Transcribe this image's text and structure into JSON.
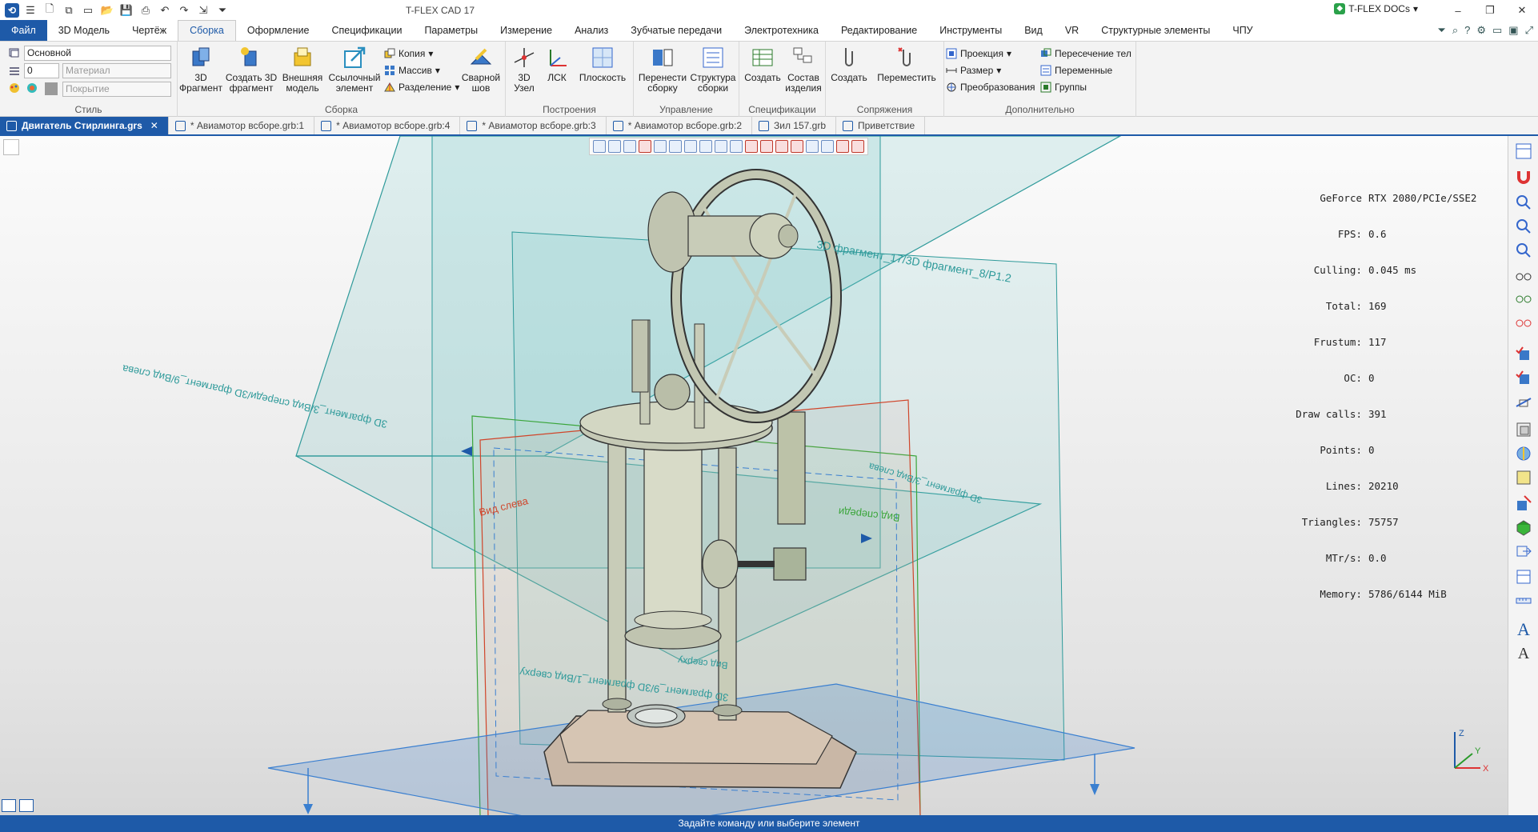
{
  "app": {
    "title": "T-FLEX CAD 17",
    "docs_label": "T-FLEX DOCs"
  },
  "menu": {
    "tabs": [
      "Файл",
      "3D Модель",
      "Чертёж",
      "Сборка",
      "Оформление",
      "Спецификации",
      "Параметры",
      "Измерение",
      "Анализ",
      "Зубчатые передачи",
      "Электротехника",
      "Редактирование",
      "Инструменты",
      "Вид",
      "VR",
      "Структурные элементы",
      "ЧПУ"
    ],
    "active": "Сборка"
  },
  "ribbon": {
    "style": {
      "label": "Стиль",
      "layer_value": "Основной",
      "level_value": "0",
      "material_placeholder": "Материал",
      "coating_placeholder": "Покрытие"
    },
    "assembly": {
      "label": "Сборка",
      "fragment_3d": "3D\nФрагмент",
      "create_fragment": "Создать 3D\nфрагмент",
      "external_model": "Внешняя\nмодель",
      "ref_element": "Ссылочный\nэлемент",
      "copy": "Копия",
      "array": "Массив",
      "split": "Разделение",
      "weld": "Сварной\nшов"
    },
    "construct": {
      "label": "Построения",
      "node3d": "3D\nУзел",
      "lcs": "ЛСК",
      "plane": "Плоскость"
    },
    "manage": {
      "label": "Управление",
      "move_asm": "Перенести\nсборку",
      "asm_structure": "Структура\nсборки"
    },
    "specs": {
      "label": "Спецификации",
      "create": "Создать",
      "products": "Состав\nизделия"
    },
    "mates": {
      "label": "Сопряжения",
      "create": "Создать",
      "move": "Переместить"
    },
    "extra": {
      "label": "Дополнительно",
      "projection": "Проекция",
      "dimension": "Размер",
      "transforms": "Преобразования",
      "body_intersect": "Пересечение тел",
      "variables": "Переменные",
      "groups": "Группы"
    }
  },
  "doc_tabs": [
    {
      "label": "Двигатель Стирлинга.grs",
      "active": true
    },
    {
      "label": "* Авиамотор всборе.grb:1",
      "active": false
    },
    {
      "label": "* Авиамотор всборе.grb:4",
      "active": false
    },
    {
      "label": "* Авиамотор всборе.grb:3",
      "active": false
    },
    {
      "label": "* Авиамотор всборе.grb:2",
      "active": false
    },
    {
      "label": "Зил 157.grb",
      "active": false
    },
    {
      "label": "Приветствие",
      "active": false
    }
  ],
  "stats": [
    {
      "k": "GeForce",
      "v": "RTX 2080/PCIe/SSE2"
    },
    {
      "k": "FPS:",
      "v": "0.6"
    },
    {
      "k": "Culling:",
      "v": "0.045 ms"
    },
    {
      "k": "Total:",
      "v": "169"
    },
    {
      "k": "Frustum:",
      "v": "117"
    },
    {
      "k": "OC:",
      "v": "0"
    },
    {
      "k": "Draw calls:",
      "v": "391"
    },
    {
      "k": "Points:",
      "v": "0"
    },
    {
      "k": "Lines:",
      "v": "20210"
    },
    {
      "k": "Triangles:",
      "v": "75757"
    },
    {
      "k": "MTr/s:",
      "v": "0.0"
    },
    {
      "k": "Memory:",
      "v": "5786/6144 MiB"
    }
  ],
  "plane_labels": {
    "frag17": "3D фрагмент_17/3D фрагмент_8/Р1.2",
    "side_left": "Вид слева",
    "front": "Вид спереди",
    "frag_left": "3D фрагмент_3/Вид слева",
    "top": "Вид сверху",
    "frag9": "3D фрагмент_9/3D фрагмент_1/Вид сверху",
    "frag_long": "3D фрагмент_3/Вид спереди/3D фрагмент_9/Вид слева"
  },
  "axes": {
    "x": "X",
    "y": "Y",
    "z": "Z"
  },
  "status": "Задайте команду или выберите элемент",
  "colors": {
    "accent": "#1e5aa8",
    "plane_teal": "#2e9a9a",
    "plane_green": "#3aa53a",
    "plane_red": "#d0452a",
    "plane_blue": "#3a7fd0"
  }
}
